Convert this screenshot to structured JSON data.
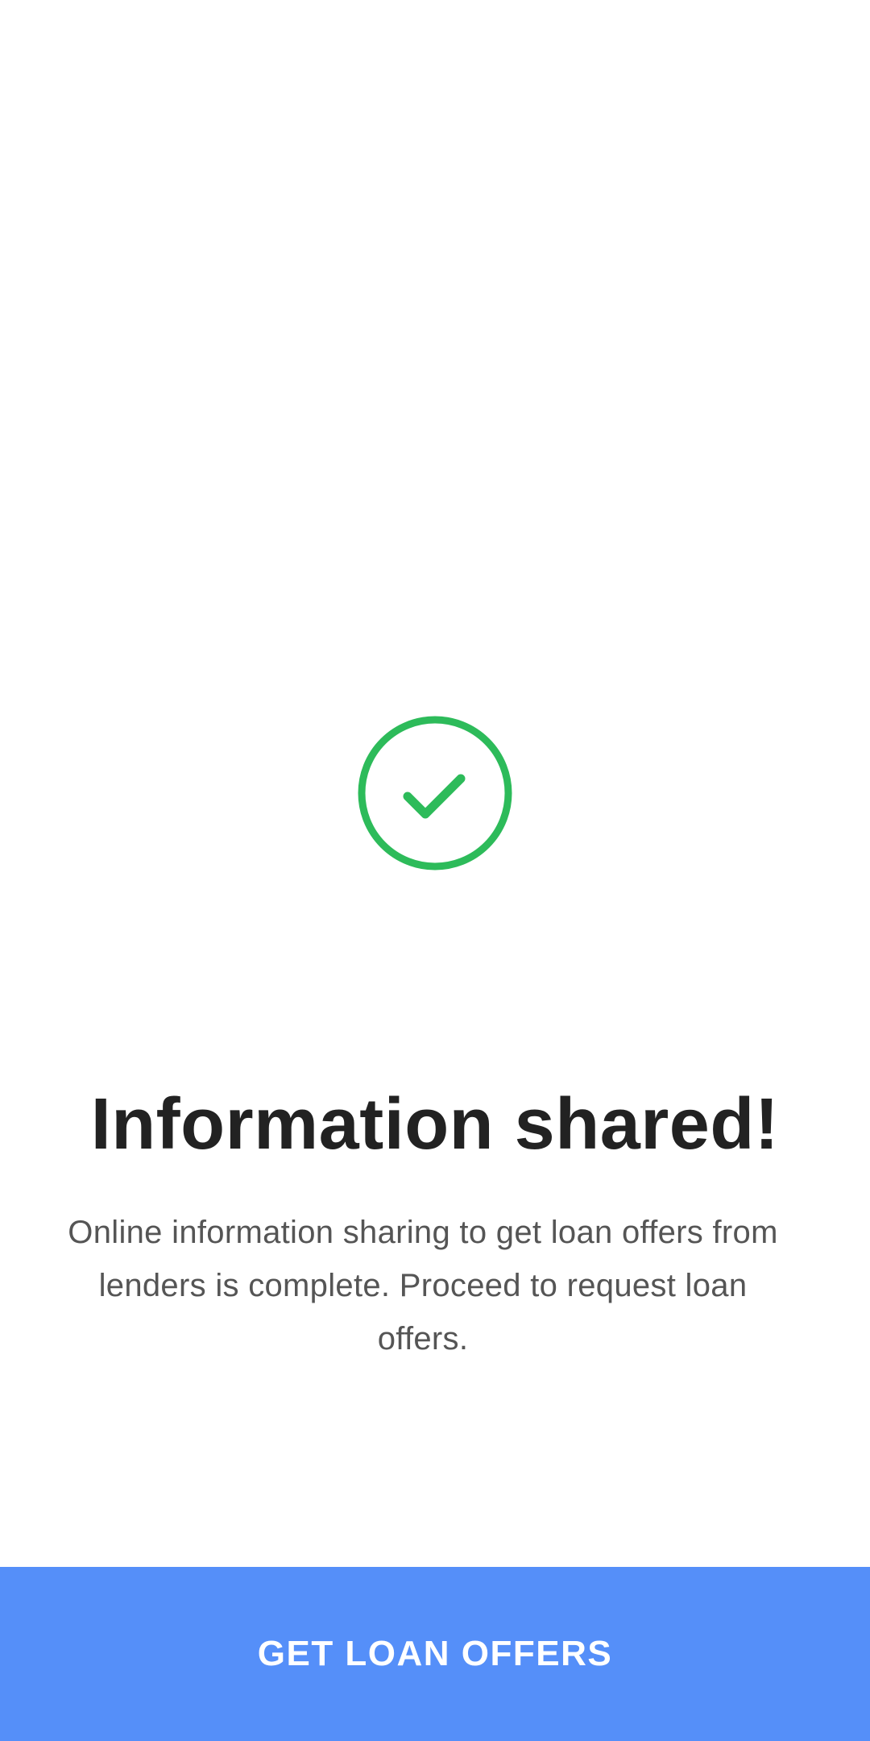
{
  "status": {
    "icon": "check-circle-icon",
    "color": "#2dbb5a"
  },
  "content": {
    "title": "Information shared!",
    "description": "Online information sharing to get loan offers from lenders is complete. Proceed to request loan offers."
  },
  "actions": {
    "primary_label": "GET LOAN OFFERS",
    "primary_color": "#558ff9"
  }
}
